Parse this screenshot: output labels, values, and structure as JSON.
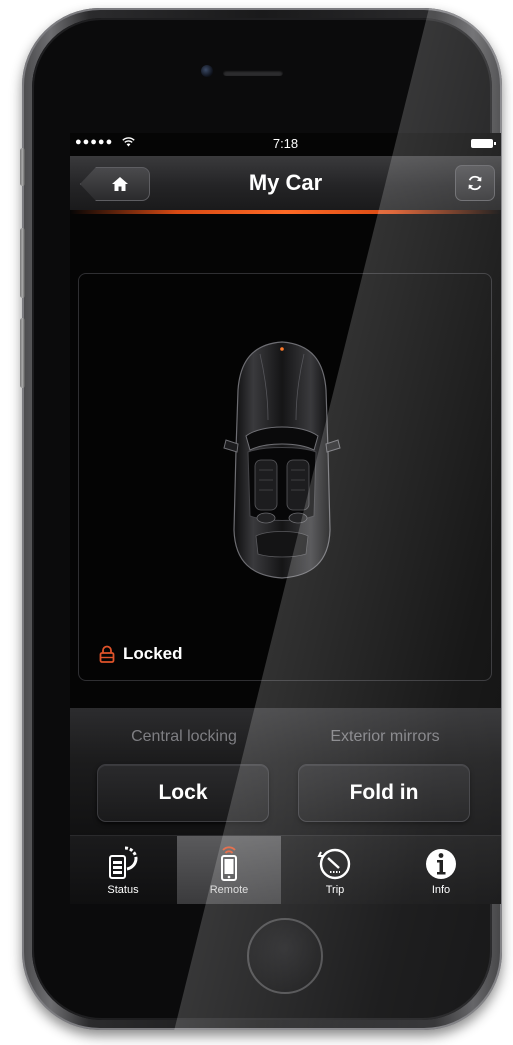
{
  "status_bar": {
    "signal": "●●●●●",
    "wifi": "wifi-icon",
    "time": "7:18",
    "battery": "battery-icon"
  },
  "nav": {
    "home_icon": "house-icon",
    "title": "My Car",
    "refresh_icon": "refresh-icon",
    "accent_color": "#ff6a26"
  },
  "car_panel": {
    "image": "convertible-car-top-view",
    "lock_status": "Locked",
    "lock_icon": "padlock-icon",
    "lock_color": "#e0532a"
  },
  "controls": {
    "central_locking": {
      "label": "Central locking",
      "button": "Lock"
    },
    "exterior_mirrors": {
      "label": "Exterior mirrors",
      "button": "Fold in"
    }
  },
  "tabs": [
    {
      "label": "Status",
      "icon": "status-icon",
      "active": false
    },
    {
      "label": "Remote",
      "icon": "remote-phone-icon",
      "active": true
    },
    {
      "label": "Trip",
      "icon": "trip-gauge-icon",
      "active": false
    },
    {
      "label": "Info",
      "icon": "info-icon",
      "active": false
    }
  ]
}
